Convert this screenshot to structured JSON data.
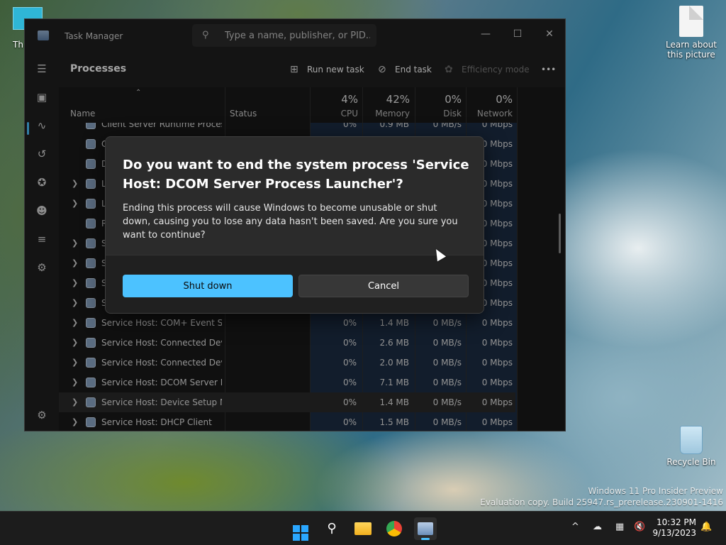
{
  "desktop": {
    "top_left_icon_label": "Th",
    "learn_about_label": "Learn about this picture",
    "recycle_bin_label": "Recycle Bin",
    "watermark_line1": "Windows 11 Pro Insider Preview",
    "watermark_line2": "Evaluation copy. Build 25947.rs_prerelease.230901-1416"
  },
  "window": {
    "title": "Task Manager",
    "search_placeholder": "Type a name, publisher, or PID...",
    "controls": {
      "minimize": "—",
      "maximize": "☐",
      "close": "✕"
    }
  },
  "toolbar": {
    "section_title": "Processes",
    "run_new_task": "Run new task",
    "end_task": "End task",
    "efficiency_mode": "Efficiency mode",
    "more": "•••"
  },
  "table": {
    "headers": {
      "name": "Name",
      "status": "Status",
      "cpu_pct": "4%",
      "cpu": "CPU",
      "memory_pct": "42%",
      "memory": "Memory",
      "disk_pct": "0%",
      "disk": "Disk",
      "network_pct": "0%",
      "network": "Network"
    },
    "rows": [
      {
        "name": "Client Server Runtime Process",
        "cpu": "0%",
        "memory": "0.9 MB",
        "disk": "0 MB/s",
        "network": "0 Mbps"
      },
      {
        "name": "C",
        "cpu": "",
        "memory": "",
        "disk": "",
        "network": "0 Mbps"
      },
      {
        "name": "D",
        "cpu": "",
        "memory": "",
        "disk": "",
        "network": "0 Mbps"
      },
      {
        "name": "L",
        "cpu": "",
        "memory": "",
        "disk": "",
        "network": "0 Mbps"
      },
      {
        "name": "L",
        "cpu": "",
        "memory": "",
        "disk": "",
        "network": "0 Mbps"
      },
      {
        "name": "R",
        "cpu": "",
        "memory": "",
        "disk": "",
        "network": "0 Mbps"
      },
      {
        "name": "S",
        "cpu": "",
        "memory": "",
        "disk": "",
        "network": "0 Mbps"
      },
      {
        "name": "S",
        "cpu": "",
        "memory": "",
        "disk": "",
        "network": "0 Mbps"
      },
      {
        "name": "S",
        "cpu": "",
        "memory": "",
        "disk": "",
        "network": "0 Mbps"
      },
      {
        "name": "S",
        "cpu": "",
        "memory": "",
        "disk": "",
        "network": "0 Mbps"
      },
      {
        "name": "Service Host: COM+ Event Sys...",
        "cpu": "0%",
        "memory": "1.4 MB",
        "disk": "0 MB/s",
        "network": "0 Mbps"
      },
      {
        "name": "Service Host: Connected Devi...",
        "cpu": "0%",
        "memory": "2.6 MB",
        "disk": "0 MB/s",
        "network": "0 Mbps"
      },
      {
        "name": "Service Host: Connected Devi...",
        "cpu": "0%",
        "memory": "2.0 MB",
        "disk": "0 MB/s",
        "network": "0 Mbps"
      },
      {
        "name": "Service Host: DCOM Server Pr...",
        "cpu": "0%",
        "memory": "7.1 MB",
        "disk": "0 MB/s",
        "network": "0 Mbps"
      },
      {
        "name": "Service Host: Device Setup Ma...",
        "cpu": "0%",
        "memory": "1.4 MB",
        "disk": "0 MB/s",
        "network": "0 Mbps"
      },
      {
        "name": "Service Host: DHCP Client",
        "cpu": "0%",
        "memory": "1.5 MB",
        "disk": "0 MB/s",
        "network": "0 Mbps"
      }
    ]
  },
  "dialog": {
    "title": "Do you want to end the system process 'Service Host: DCOM Server Process Launcher'?",
    "body": "Ending this process will cause Windows to become unusable or shut down, causing you to lose any data hasn't been saved. Are you sure you want to continue?",
    "primary_button": "Shut down",
    "secondary_button": "Cancel"
  },
  "taskbar": {
    "time": "10:32 PM",
    "date": "9/13/2023",
    "overflow_chevron": "^"
  },
  "colors": {
    "accent": "#4cc2ff",
    "window_bg": "#202020",
    "dialog_bg": "#2b2b2b"
  }
}
